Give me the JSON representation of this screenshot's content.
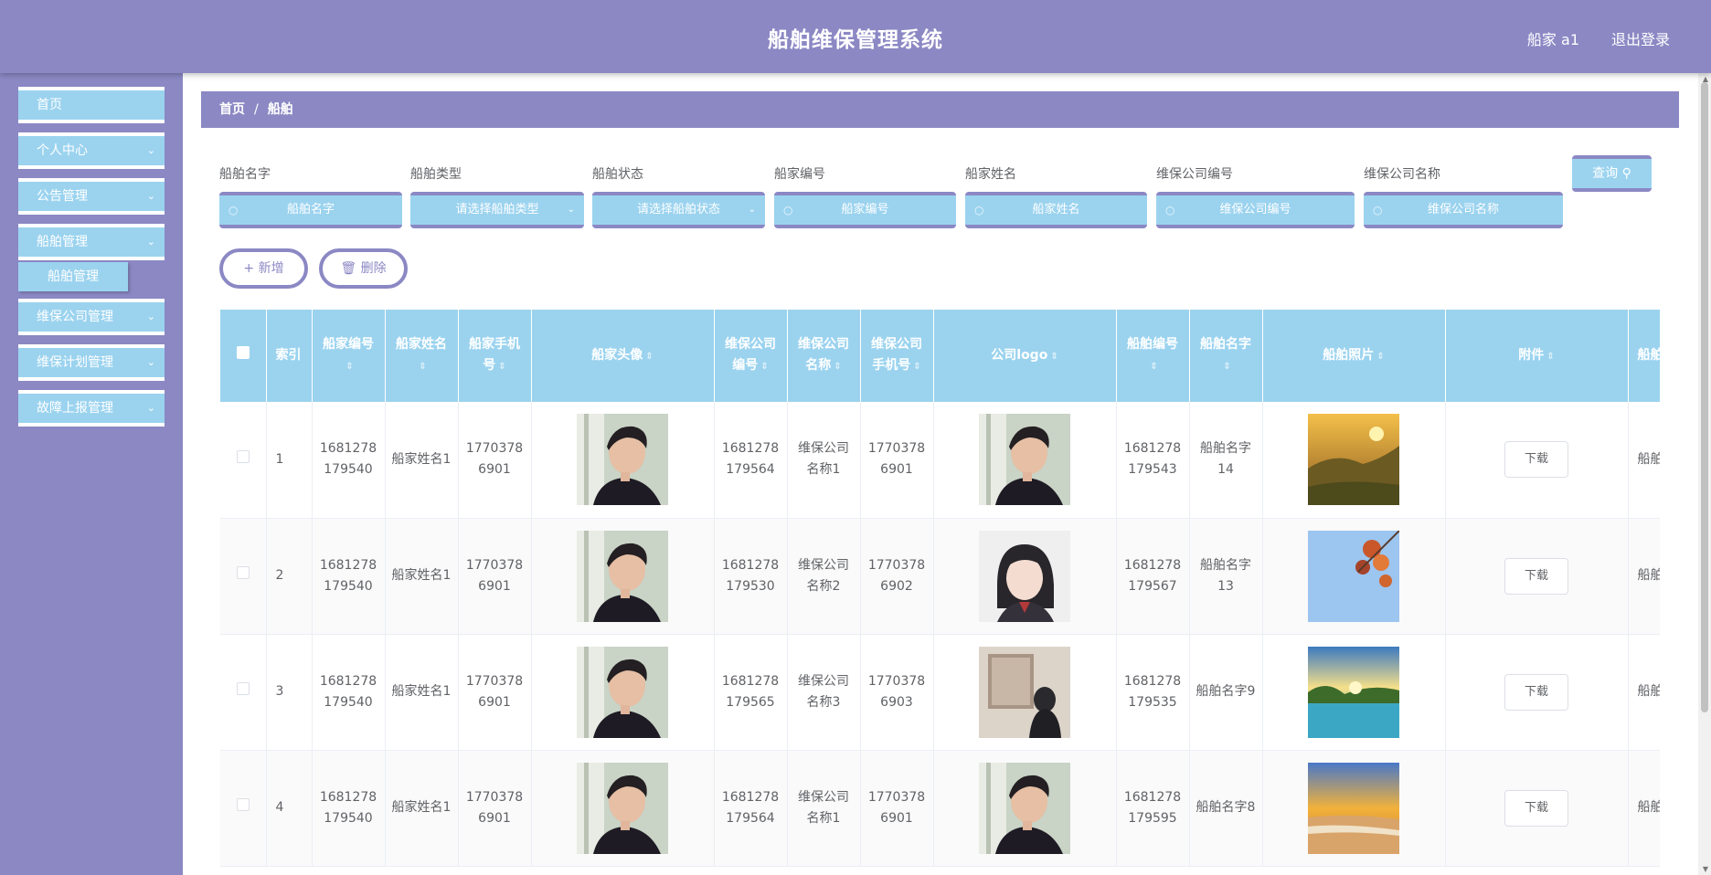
{
  "header": {
    "title": "船舶维保管理系统",
    "user": "船家 a1",
    "logout": "退出登录"
  },
  "sidebar": {
    "items": [
      {
        "label": "首页",
        "chevron": false
      },
      {
        "label": "个人中心",
        "chevron": true
      },
      {
        "label": "公告管理",
        "chevron": true
      },
      {
        "label": "船舶管理",
        "chevron": true
      },
      {
        "label": "维保公司管理",
        "chevron": true
      },
      {
        "label": "维保计划管理",
        "chevron": true
      },
      {
        "label": "故障上报管理",
        "chevron": true
      }
    ],
    "submenu": {
      "label": "船舶管理"
    }
  },
  "breadcrumb": {
    "home": "首页",
    "separator": "/",
    "current": "船舶"
  },
  "search": {
    "fields": [
      {
        "label": "船舶名字",
        "placeholder": "船舶名字",
        "type": "input"
      },
      {
        "label": "船舶类型",
        "placeholder": "请选择船舶类型",
        "type": "select"
      },
      {
        "label": "船舶状态",
        "placeholder": "请选择船舶状态",
        "type": "select"
      },
      {
        "label": "船家编号",
        "placeholder": "船家编号",
        "type": "input"
      },
      {
        "label": "船家姓名",
        "placeholder": "船家姓名",
        "type": "input"
      },
      {
        "label": "维保公司编号",
        "placeholder": "维保公司编号",
        "type": "input"
      },
      {
        "label": "维保公司名称",
        "placeholder": "维保公司名称",
        "type": "input"
      }
    ],
    "query_label": "查询"
  },
  "actions": {
    "add_label": "新增",
    "delete_label": "删除"
  },
  "table": {
    "headers": {
      "index": "索引",
      "owner_no": "船家编号",
      "owner_name": "船家姓名",
      "owner_phone": "船家手机号",
      "owner_avatar": "船家头像",
      "company_no": "维保公司编号",
      "company_name": "维保公司名称",
      "company_phone": "维保公司手机号",
      "company_logo": "公司logo",
      "ship_no": "船舶编号",
      "ship_name": "船舶名字",
      "ship_photo": "船舶照片",
      "attachment": "附件",
      "ship_type": "船舶"
    },
    "download_label": "下载",
    "rows": [
      {
        "index": "1",
        "owner_no": "1681278179540",
        "owner_name": "船家姓名1",
        "owner_phone": "17703786901",
        "company_no": "1681278179564",
        "company_name": "维保公司名称1",
        "company_phone": "17703786901",
        "ship_no": "1681278179543",
        "ship_name": "船舶名字14",
        "ship_type": "船舶",
        "logo": "man",
        "photo": "meadow"
      },
      {
        "index": "2",
        "owner_no": "1681278179540",
        "owner_name": "船家姓名1",
        "owner_phone": "17703786901",
        "company_no": "1681278179530",
        "company_name": "维保公司名称2",
        "company_phone": "17703786902",
        "ship_no": "1681278179567",
        "ship_name": "船舶名字13",
        "ship_type": "船舶",
        "logo": "girl",
        "photo": "leaves"
      },
      {
        "index": "3",
        "owner_no": "1681278179540",
        "owner_name": "船家姓名1",
        "owner_phone": "17703786901",
        "company_no": "1681278179565",
        "company_name": "维保公司名称3",
        "company_phone": "17703786903",
        "ship_no": "1681278179535",
        "ship_name": "船舶名字9",
        "ship_type": "船舶",
        "logo": "gallery",
        "photo": "lake"
      },
      {
        "index": "4",
        "owner_no": "1681278179540",
        "owner_name": "船家姓名1",
        "owner_phone": "17703786901",
        "company_no": "1681278179564",
        "company_name": "维保公司名称1",
        "company_phone": "17703786901",
        "ship_no": "1681278179595",
        "ship_name": "船舶名字8",
        "ship_type": "船舶",
        "logo": "man",
        "photo": "beach"
      }
    ]
  },
  "colors": {
    "primary": "#8b88c4",
    "accent": "#9bd3ef",
    "text": "#606266"
  }
}
